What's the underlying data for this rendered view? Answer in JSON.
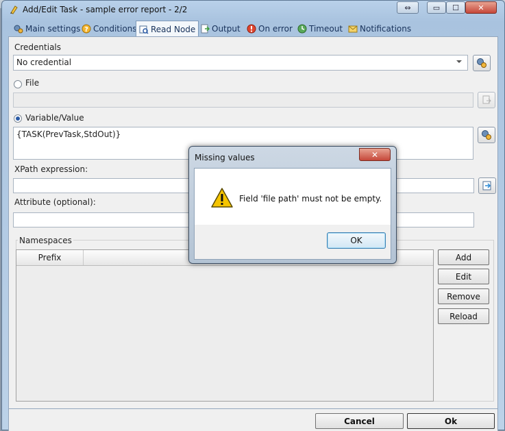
{
  "window": {
    "title": "Add/Edit Task - sample error report - 2/2",
    "restore_symbol": "⇔",
    "min_symbol": "▭",
    "max_symbol": "☐",
    "close_symbol": "✕"
  },
  "tabs": [
    {
      "label": "Main settings",
      "icon": "gears-icon"
    },
    {
      "label": "Conditions",
      "icon": "question-icon"
    },
    {
      "label": "Read Node",
      "icon": "read-node-icon",
      "active": true
    },
    {
      "label": "Output",
      "icon": "output-icon"
    },
    {
      "label": "On error",
      "icon": "error-icon"
    },
    {
      "label": "Timeout",
      "icon": "timeout-icon"
    },
    {
      "label": "Notifications",
      "icon": "envelope-icon"
    }
  ],
  "form": {
    "credentials_label": "Credentials",
    "credentials_value": "No credential",
    "file_label": "File",
    "file_value": "",
    "variable_label": "Variable/Value",
    "variable_value": "{TASK(PrevTask,StdOut)}",
    "xpath_label": "XPath expression:",
    "xpath_value": "",
    "attribute_label": "Attribute (optional):",
    "attribute_value": "",
    "namespaces_label": "Namespaces",
    "grid_col_prefix": "Prefix",
    "grid_col_rest": ""
  },
  "side_buttons": {
    "add": "Add",
    "edit": "Edit",
    "remove": "Remove",
    "reload": "Reload"
  },
  "bottom": {
    "cancel": "Cancel",
    "ok": "Ok"
  },
  "modal": {
    "title": "Missing values",
    "message": "Field 'file path' must not be empty.",
    "ok": "OK",
    "close_symbol": "✕"
  },
  "colors": {
    "accent": "#2b5ba6",
    "warning_fill": "#f5c400",
    "close_red": "#c6483a"
  }
}
